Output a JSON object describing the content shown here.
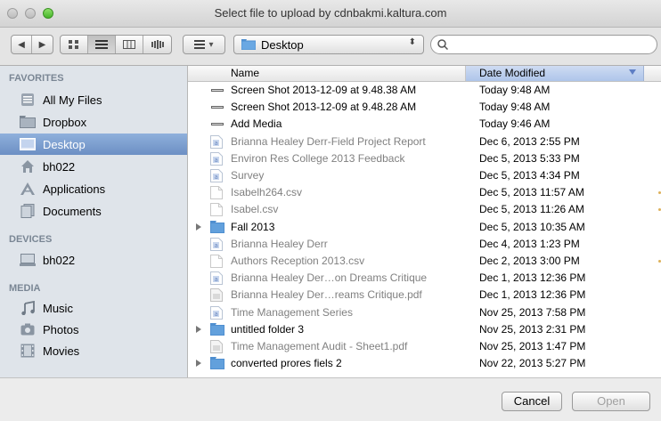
{
  "window": {
    "title": "Select file to upload by cdnbakmi.kaltura.com"
  },
  "toolbar": {
    "location": "Desktop",
    "search_value": ""
  },
  "sidebar": {
    "sections": [
      {
        "label": "FAVORITES",
        "items": [
          {
            "label": "All My Files",
            "icon": "all-files-icon"
          },
          {
            "label": "Dropbox",
            "icon": "folder-icon"
          },
          {
            "label": "Desktop",
            "icon": "desktop-icon",
            "selected": true
          },
          {
            "label": "bh022",
            "icon": "home-icon"
          },
          {
            "label": "Applications",
            "icon": "applications-icon"
          },
          {
            "label": "Documents",
            "icon": "documents-icon"
          }
        ]
      },
      {
        "label": "DEVICES",
        "items": [
          {
            "label": "bh022",
            "icon": "computer-icon"
          }
        ]
      },
      {
        "label": "MEDIA",
        "items": [
          {
            "label": "Music",
            "icon": "music-icon"
          },
          {
            "label": "Photos",
            "icon": "camera-icon"
          },
          {
            "label": "Movies",
            "icon": "film-icon"
          }
        ]
      }
    ]
  },
  "list": {
    "columns": {
      "name": "Name",
      "date": "Date Modified"
    },
    "rows": [
      {
        "name": "Screen Shot 2013-12-09 at 9.48.38 AM",
        "date": "Today 9:48 AM",
        "icon": "screenshot-icon",
        "enabled": true
      },
      {
        "name": "Screen Shot 2013-12-09 at 9.48.28 AM",
        "date": "Today 9:48 AM",
        "icon": "screenshot-icon",
        "enabled": true
      },
      {
        "name": "Add Media",
        "date": "Today 9:46 AM",
        "icon": "screenshot-icon",
        "enabled": true
      },
      {
        "name": "Brianna Healey Derr-Field Project Report",
        "date": "Dec 6, 2013 2:55 PM",
        "icon": "document-icon",
        "enabled": false
      },
      {
        "name": "Environ Res College 2013 Feedback",
        "date": "Dec 5, 2013 5:33 PM",
        "icon": "document-icon",
        "enabled": false
      },
      {
        "name": "Survey",
        "date": "Dec 5, 2013 4:34 PM",
        "icon": "document-icon",
        "enabled": false
      },
      {
        "name": "Isabelh264.csv",
        "date": "Dec 5, 2013 11:57 AM",
        "icon": "blank-file-icon",
        "enabled": false,
        "tag": true
      },
      {
        "name": "Isabel.csv",
        "date": "Dec 5, 2013 11:26 AM",
        "icon": "blank-file-icon",
        "enabled": false,
        "tag": true
      },
      {
        "name": "Fall 2013",
        "date": "Dec 5, 2013 10:35 AM",
        "icon": "folder-icon",
        "enabled": true,
        "folder": true
      },
      {
        "name": "Brianna Healey Derr",
        "date": "Dec 4, 2013 1:23 PM",
        "icon": "document-icon",
        "enabled": false
      },
      {
        "name": "Authors Reception 2013.csv",
        "date": "Dec 2, 2013 3:00 PM",
        "icon": "blank-file-icon",
        "enabled": false,
        "tag": true
      },
      {
        "name": "Brianna Healey Der…on Dreams Critique",
        "date": "Dec 1, 2013 12:36 PM",
        "icon": "document-icon",
        "enabled": false
      },
      {
        "name": "Brianna Healey Der…reams Critique.pdf",
        "date": "Dec 1, 2013 12:36 PM",
        "icon": "pdf-icon",
        "enabled": false
      },
      {
        "name": "Time Management Series",
        "date": "Nov 25, 2013 7:58 PM",
        "icon": "document-icon",
        "enabled": false
      },
      {
        "name": "untitled folder 3",
        "date": "Nov 25, 2013 2:31 PM",
        "icon": "folder-icon",
        "enabled": true,
        "folder": true
      },
      {
        "name": "Time Management Audit - Sheet1.pdf",
        "date": "Nov 25, 2013 1:47 PM",
        "icon": "pdf-icon",
        "enabled": false
      },
      {
        "name": "converted prores fiels 2",
        "date": "Nov 22, 2013 5:27 PM",
        "icon": "folder-icon",
        "enabled": true,
        "folder": true
      }
    ]
  },
  "buttons": {
    "cancel": "Cancel",
    "open": "Open"
  },
  "colors": {
    "selection": "#7395c9",
    "column_header": "#b9cdef",
    "folder": "#62a0dc"
  }
}
